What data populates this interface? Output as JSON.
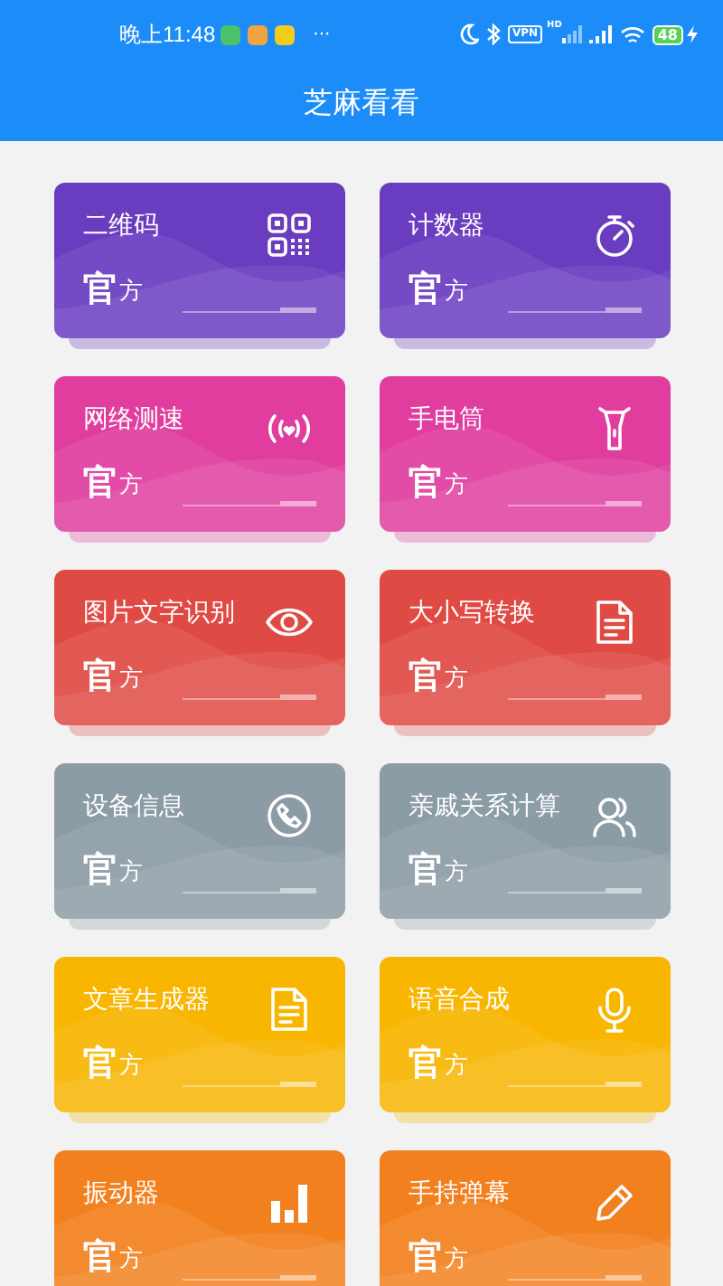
{
  "status_bar": {
    "time": "晚上11:48",
    "more": "···",
    "vpn": "VPN",
    "network_type": "HD",
    "battery": "48"
  },
  "header": {
    "title": "芝麻看看"
  },
  "tools": [
    {
      "title": "二维码",
      "kind": "qr",
      "color": "#6a3cc0",
      "tag_big": "官",
      "tag_small": "方"
    },
    {
      "title": "计数器",
      "kind": "stopwatch",
      "color": "#6a3cc0",
      "tag_big": "官",
      "tag_small": "方"
    },
    {
      "title": "网络测速",
      "kind": "signal",
      "color": "#e03d9f",
      "tag_big": "官",
      "tag_small": "方"
    },
    {
      "title": "手电筒",
      "kind": "flashlight",
      "color": "#e03d9f",
      "tag_big": "官",
      "tag_small": "方"
    },
    {
      "title": "图片文字识别",
      "kind": "eye",
      "color": "#e04a44",
      "tag_big": "官",
      "tag_small": "方"
    },
    {
      "title": "大小写转换",
      "kind": "document",
      "color": "#e04a44",
      "tag_big": "官",
      "tag_small": "方"
    },
    {
      "title": "设备信息",
      "kind": "phone",
      "color": "#8c9ca5",
      "tag_big": "官",
      "tag_small": "方"
    },
    {
      "title": "亲戚关系计算",
      "kind": "people",
      "color": "#8c9ca5",
      "tag_big": "官",
      "tag_small": "方"
    },
    {
      "title": "文章生成器",
      "kind": "document",
      "color": "#f8b600",
      "tag_big": "官",
      "tag_small": "方"
    },
    {
      "title": "语音合成",
      "kind": "microphone",
      "color": "#f8b600",
      "tag_big": "官",
      "tag_small": "方"
    },
    {
      "title": "振动器",
      "kind": "bars",
      "color": "#f2801f",
      "tag_big": "官",
      "tag_small": "方"
    },
    {
      "title": "手持弹幕",
      "kind": "pencil",
      "color": "#f2801f",
      "tag_big": "官",
      "tag_small": "方"
    }
  ]
}
